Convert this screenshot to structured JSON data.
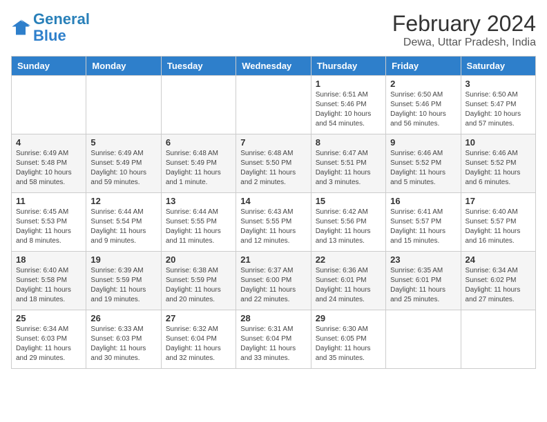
{
  "logo": {
    "text_general": "General",
    "text_blue": "Blue"
  },
  "header": {
    "title": "February 2024",
    "subtitle": "Dewa, Uttar Pradesh, India"
  },
  "days": [
    "Sunday",
    "Monday",
    "Tuesday",
    "Wednesday",
    "Thursday",
    "Friday",
    "Saturday"
  ],
  "weeks": [
    [
      {
        "date": "",
        "info": ""
      },
      {
        "date": "",
        "info": ""
      },
      {
        "date": "",
        "info": ""
      },
      {
        "date": "",
        "info": ""
      },
      {
        "date": "1",
        "info": "Sunrise: 6:51 AM\nSunset: 5:46 PM\nDaylight: 10 hours and 54 minutes."
      },
      {
        "date": "2",
        "info": "Sunrise: 6:50 AM\nSunset: 5:46 PM\nDaylight: 10 hours and 56 minutes."
      },
      {
        "date": "3",
        "info": "Sunrise: 6:50 AM\nSunset: 5:47 PM\nDaylight: 10 hours and 57 minutes."
      }
    ],
    [
      {
        "date": "4",
        "info": "Sunrise: 6:49 AM\nSunset: 5:48 PM\nDaylight: 10 hours and 58 minutes."
      },
      {
        "date": "5",
        "info": "Sunrise: 6:49 AM\nSunset: 5:49 PM\nDaylight: 10 hours and 59 minutes."
      },
      {
        "date": "6",
        "info": "Sunrise: 6:48 AM\nSunset: 5:49 PM\nDaylight: 11 hours and 1 minute."
      },
      {
        "date": "7",
        "info": "Sunrise: 6:48 AM\nSunset: 5:50 PM\nDaylight: 11 hours and 2 minutes."
      },
      {
        "date": "8",
        "info": "Sunrise: 6:47 AM\nSunset: 5:51 PM\nDaylight: 11 hours and 3 minutes."
      },
      {
        "date": "9",
        "info": "Sunrise: 6:46 AM\nSunset: 5:52 PM\nDaylight: 11 hours and 5 minutes."
      },
      {
        "date": "10",
        "info": "Sunrise: 6:46 AM\nSunset: 5:52 PM\nDaylight: 11 hours and 6 minutes."
      }
    ],
    [
      {
        "date": "11",
        "info": "Sunrise: 6:45 AM\nSunset: 5:53 PM\nDaylight: 11 hours and 8 minutes."
      },
      {
        "date": "12",
        "info": "Sunrise: 6:44 AM\nSunset: 5:54 PM\nDaylight: 11 hours and 9 minutes."
      },
      {
        "date": "13",
        "info": "Sunrise: 6:44 AM\nSunset: 5:55 PM\nDaylight: 11 hours and 11 minutes."
      },
      {
        "date": "14",
        "info": "Sunrise: 6:43 AM\nSunset: 5:55 PM\nDaylight: 11 hours and 12 minutes."
      },
      {
        "date": "15",
        "info": "Sunrise: 6:42 AM\nSunset: 5:56 PM\nDaylight: 11 hours and 13 minutes."
      },
      {
        "date": "16",
        "info": "Sunrise: 6:41 AM\nSunset: 5:57 PM\nDaylight: 11 hours and 15 minutes."
      },
      {
        "date": "17",
        "info": "Sunrise: 6:40 AM\nSunset: 5:57 PM\nDaylight: 11 hours and 16 minutes."
      }
    ],
    [
      {
        "date": "18",
        "info": "Sunrise: 6:40 AM\nSunset: 5:58 PM\nDaylight: 11 hours and 18 minutes."
      },
      {
        "date": "19",
        "info": "Sunrise: 6:39 AM\nSunset: 5:59 PM\nDaylight: 11 hours and 19 minutes."
      },
      {
        "date": "20",
        "info": "Sunrise: 6:38 AM\nSunset: 5:59 PM\nDaylight: 11 hours and 20 minutes."
      },
      {
        "date": "21",
        "info": "Sunrise: 6:37 AM\nSunset: 6:00 PM\nDaylight: 11 hours and 22 minutes."
      },
      {
        "date": "22",
        "info": "Sunrise: 6:36 AM\nSunset: 6:01 PM\nDaylight: 11 hours and 24 minutes."
      },
      {
        "date": "23",
        "info": "Sunrise: 6:35 AM\nSunset: 6:01 PM\nDaylight: 11 hours and 25 minutes."
      },
      {
        "date": "24",
        "info": "Sunrise: 6:34 AM\nSunset: 6:02 PM\nDaylight: 11 hours and 27 minutes."
      }
    ],
    [
      {
        "date": "25",
        "info": "Sunrise: 6:34 AM\nSunset: 6:03 PM\nDaylight: 11 hours and 29 minutes."
      },
      {
        "date": "26",
        "info": "Sunrise: 6:33 AM\nSunset: 6:03 PM\nDaylight: 11 hours and 30 minutes."
      },
      {
        "date": "27",
        "info": "Sunrise: 6:32 AM\nSunset: 6:04 PM\nDaylight: 11 hours and 32 minutes."
      },
      {
        "date": "28",
        "info": "Sunrise: 6:31 AM\nSunset: 6:04 PM\nDaylight: 11 hours and 33 minutes."
      },
      {
        "date": "29",
        "info": "Sunrise: 6:30 AM\nSunset: 6:05 PM\nDaylight: 11 hours and 35 minutes."
      },
      {
        "date": "",
        "info": ""
      },
      {
        "date": "",
        "info": ""
      }
    ]
  ]
}
